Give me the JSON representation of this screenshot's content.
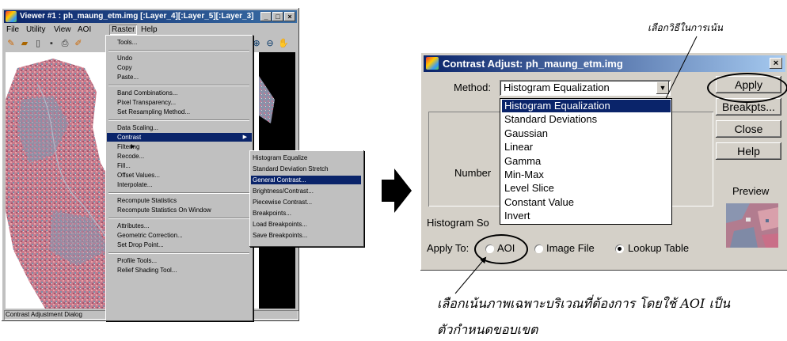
{
  "viewer": {
    "title": "Viewer #1 : ph_maung_etm.img [:Layer_4][:Layer_5][:Layer_3]",
    "window_buttons": [
      "_",
      "□",
      "×"
    ],
    "menus": [
      "File",
      "Utility",
      "View",
      "AOI",
      "Raster",
      "Help"
    ],
    "active_menu": "Raster",
    "status": "Contrast Adjustment Dialog"
  },
  "raster_menu": {
    "items": [
      {
        "label": "Tools..."
      },
      {
        "sep": true
      },
      {
        "label": "Undo"
      },
      {
        "label": "Copy"
      },
      {
        "label": "Paste..."
      },
      {
        "sep": true
      },
      {
        "label": "Band Combinations..."
      },
      {
        "label": "Pixel Transparency..."
      },
      {
        "label": "Set Resampling Method..."
      },
      {
        "sep": true
      },
      {
        "label": "Data Scaling..."
      },
      {
        "label": "Contrast",
        "highlighted": true,
        "submenu": true
      },
      {
        "label": "Filtering",
        "submenu": true
      },
      {
        "label": "Recode..."
      },
      {
        "label": "Fill..."
      },
      {
        "label": "Offset Values..."
      },
      {
        "label": "Interpolate..."
      },
      {
        "sep": true
      },
      {
        "label": "Recompute Statistics"
      },
      {
        "label": "Recompute Statistics On Window"
      },
      {
        "sep": true
      },
      {
        "label": "Attributes..."
      },
      {
        "label": "Geometric Correction..."
      },
      {
        "label": "Set Drop Point..."
      },
      {
        "sep": true
      },
      {
        "label": "Profile Tools..."
      },
      {
        "label": "Relief Shading Tool..."
      }
    ]
  },
  "contrast_submenu": {
    "items": [
      {
        "label": "Histogram Equalize"
      },
      {
        "label": "Standard Deviation Stretch"
      },
      {
        "label": "General Contrast...",
        "highlighted": true
      },
      {
        "label": "Brightness/Contrast..."
      },
      {
        "label": "Piecewise Contrast..."
      },
      {
        "label": "Breakpoints..."
      },
      {
        "label": "Load Breakpoints..."
      },
      {
        "label": "Save Breakpoints..."
      }
    ]
  },
  "dialog": {
    "title": "Contrast Adjust: ph_maung_etm.img",
    "close": "×",
    "method_label": "Method:",
    "method_value": "Histogram Equalization",
    "method_options": [
      "Histogram Equalization",
      "Standard Deviations",
      "Gaussian",
      "Linear",
      "Gamma",
      "Min-Max",
      "Level Slice",
      "Constant Value",
      "Invert"
    ],
    "number_label": "Number",
    "histogram_source_label": "Histogram So",
    "apply_to_label": "Apply To:",
    "apply_to_options": [
      {
        "label": "AOI",
        "checked": false
      },
      {
        "label": "Image File",
        "checked": false
      },
      {
        "label": "Lookup Table",
        "checked": true
      }
    ],
    "buttons": {
      "apply": "Apply",
      "breakpts": "Breakpts...",
      "close": "Close",
      "help": "Help"
    },
    "preview_label": "Preview"
  },
  "annotations": {
    "top": "เลือกวิธีในการเน้น",
    "bottom_line1": "เลือกเน้นภาพเฉพาะบริเวณที่ต้องการ โดยใช้ AOI เป็น",
    "bottom_line2": "ตัวกำหนดขอบเขต"
  }
}
